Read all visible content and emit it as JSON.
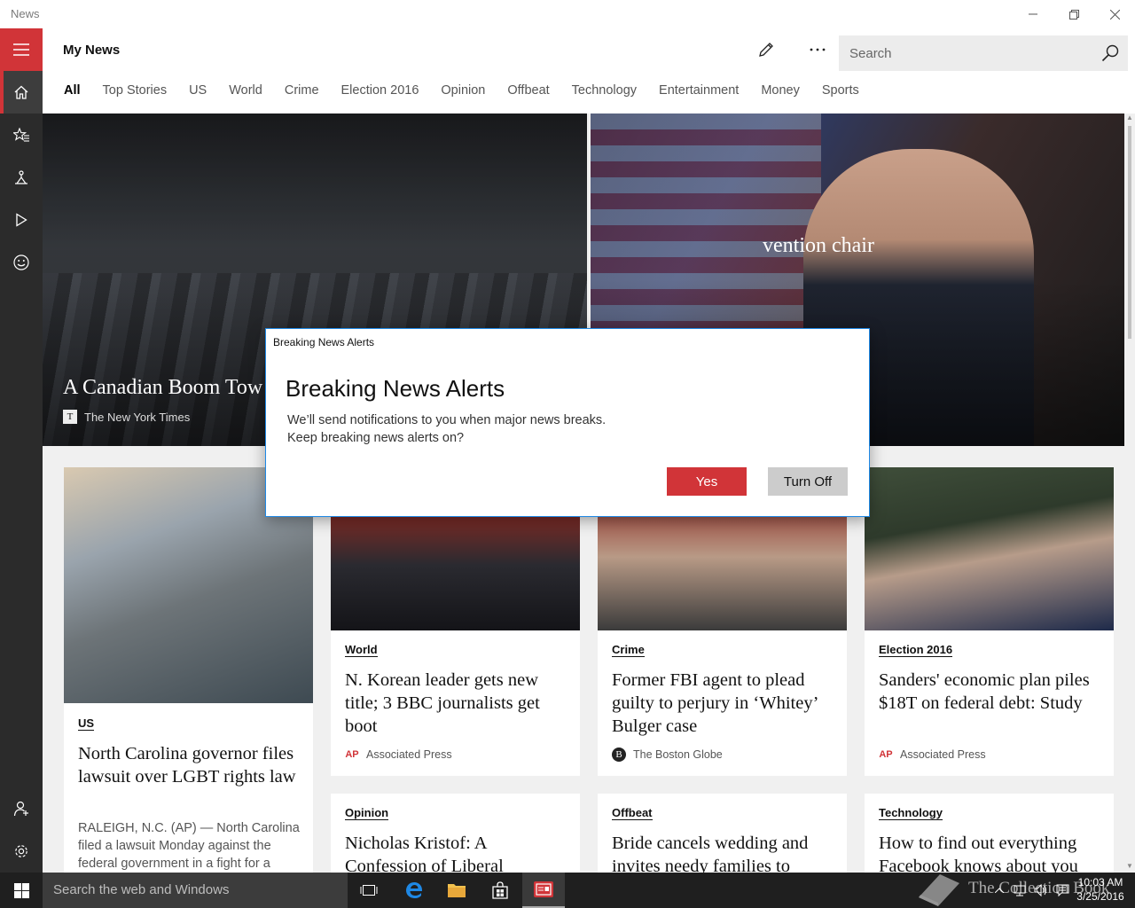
{
  "window": {
    "title": "News"
  },
  "header": {
    "page_title": "My News",
    "search_placeholder": "Search",
    "tabs": [
      "All",
      "Top Stories",
      "US",
      "World",
      "Crime",
      "Election 2016",
      "Opinion",
      "Offbeat",
      "Technology",
      "Entertainment",
      "Money",
      "Sports"
    ],
    "active_tab": "All"
  },
  "rail": {
    "items": [
      "home-icon",
      "favorites-icon",
      "local-icon",
      "video-icon",
      "interests-icon",
      "account-icon",
      "settings-icon"
    ]
  },
  "hero": {
    "left": {
      "title": "A Canadian Boom Tow",
      "source": "The New York Times"
    },
    "right": {
      "title": "vention chair"
    }
  },
  "cards": [
    {
      "category": "US",
      "headline": "North Carolina governor files lawsuit over LGBT rights law",
      "snippet": "RALEIGH, N.C. (AP) — North Carolina filed a lawsuit Monday against the federal government in a fight for a"
    },
    {
      "category": "World",
      "headline": "N. Korean leader gets new title; 3 BBC journalists get boot",
      "source": "Associated Press",
      "source_logo": "AP"
    },
    {
      "category": "Crime",
      "headline": "Former FBI agent to plead guilty to perjury in ‘Whitey’ Bulger case",
      "source": "The Boston Globe",
      "source_logo": "B"
    },
    {
      "category": "Election 2016",
      "headline": "Sanders' economic plan piles $18T on federal debt: Study",
      "source": "Associated Press",
      "source_logo": "AP"
    },
    {
      "category": "Opinion",
      "headline": "Nicholas Kristof: A Confession of Liberal"
    },
    {
      "category": "Offbeat",
      "headline": "Bride cancels wedding and invites needy families to"
    },
    {
      "category": "Technology",
      "headline": "How to find out everything Facebook knows about you"
    }
  ],
  "dialog": {
    "titlebar": "Breaking News Alerts",
    "heading": "Breaking News Alerts",
    "body_line1": "We’ll send notifications to you when major news breaks.",
    "body_line2": "Keep breaking news alerts on?",
    "yes_label": "Yes",
    "off_label": "Turn Off"
  },
  "taskbar": {
    "search_placeholder": "Search the web and Windows",
    "apps": [
      "task-view-icon",
      "edge-icon",
      "file-explorer-icon",
      "store-icon",
      "news-icon"
    ],
    "time": "10:03 AM",
    "date": "3/25/2016",
    "watermark": "The Collection Book"
  },
  "colors": {
    "accent": "#d13438",
    "rail": "#2b2b2b",
    "taskbar": "#1f1f1f",
    "dialog_border": "#1e88e5"
  }
}
